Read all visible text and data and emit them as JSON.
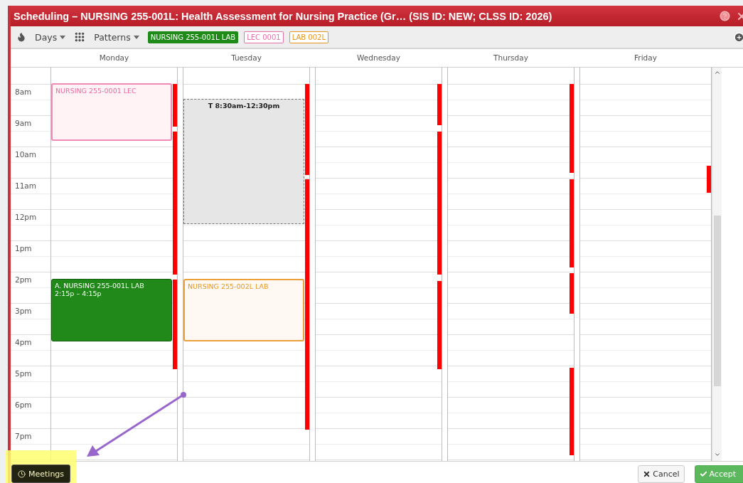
{
  "window": {
    "title": "Scheduling – NURSING 255-001L: Health Assessment for Nursing Practice (Gr… (SIS ID: NEW; CLSS ID: 2026)"
  },
  "toolbar": {
    "menus": [
      {
        "label": "Days"
      },
      {
        "label": "Patterns"
      }
    ],
    "tags": [
      {
        "label": "NURSING 255-001L LAB",
        "color": "#1e8a17",
        "selected": true
      },
      {
        "label": "LEC 0001",
        "color": "#e870a8",
        "selected": false
      },
      {
        "label": "LAB 002L",
        "color": "#e8961e",
        "selected": false
      }
    ]
  },
  "hours": [
    "8am",
    "9am",
    "10am",
    "11am",
    "12pm",
    "1pm",
    "2pm",
    "3pm",
    "4pm",
    "5pm",
    "6pm",
    "7pm"
  ],
  "days": [
    {
      "name": "Monday",
      "events": [
        {
          "kind": "lec",
          "title": "NURSING 255-0001 LEC"
        },
        {
          "kind": "current",
          "title": "A. NURSING 255-001L LAB",
          "time": "2:15p – 4:15p"
        }
      ]
    },
    {
      "name": "Tuesday",
      "events": [
        {
          "kind": "pattern",
          "title": "T 8:30am-12:30pm"
        },
        {
          "kind": "lab",
          "title": "NURSING 255-002L LAB"
        }
      ]
    },
    {
      "name": "Wednesday"
    },
    {
      "name": "Thursday"
    },
    {
      "name": "Friday"
    }
  ],
  "footer": {
    "meetings_button": "Meetings",
    "cancel_button": "Cancel",
    "accept_button": "Accept"
  }
}
